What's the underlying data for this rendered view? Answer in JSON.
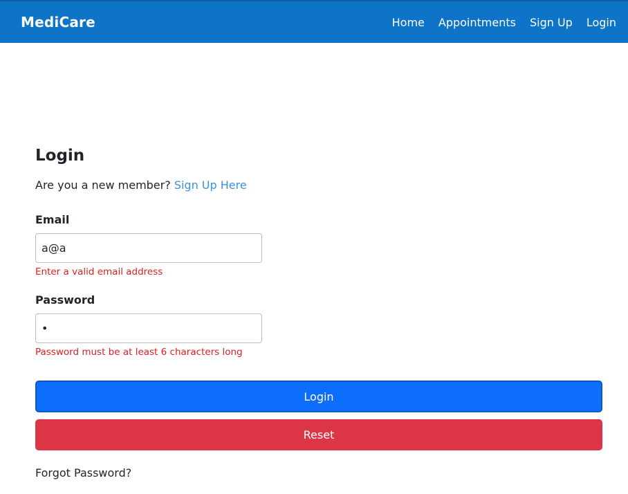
{
  "navbar": {
    "brand": "MediCare",
    "links": [
      "Home",
      "Appointments",
      "Sign Up",
      "Login"
    ]
  },
  "login_form": {
    "title": "Login",
    "new_member_prompt": "Are you a new member?",
    "signup_link": "Sign Up Here",
    "email": {
      "label": "Email",
      "value": "a@a",
      "error": "Enter a valid email address"
    },
    "password": {
      "label": "Password",
      "value": "•",
      "error": "Password must be at least 6 characters long"
    },
    "login_button": "Login",
    "reset_button": "Reset",
    "forgot_password": "Forgot Password?"
  },
  "colors": {
    "navbar": "#0d74c8",
    "primary": "#0d6efd",
    "danger": "#dc3545",
    "error_text": "#dc1f1f",
    "link": "#3b8fe3"
  }
}
